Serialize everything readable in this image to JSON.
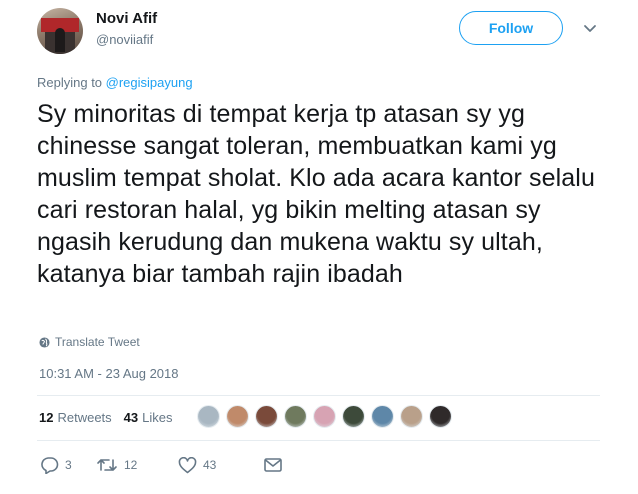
{
  "author": {
    "name": "Novi Afif",
    "handle": "@noviiafif"
  },
  "follow_label": "Follow",
  "reply_context": {
    "prefix": "Replying to ",
    "mention": "@regisipayung"
  },
  "tweet": {
    "text": "Sy minoritas di tempat kerja tp atasan sy yg chinesse sangat toleran, membuatkan kami yg muslim tempat sholat. Klo ada acara kantor selalu cari restoran halal, yg bikin melting atasan sy ngasih kerudung dan mukena waktu sy ultah, katanya biar tambah rajin ibadah",
    "translate_label": "Translate Tweet",
    "timestamp": "10:31 AM - 23 Aug 2018"
  },
  "stats": {
    "retweets_count": "12",
    "retweets_label": "Retweets",
    "likes_count": "43",
    "likes_label": "Likes"
  },
  "liker_avatars": [
    {
      "color": "#a9b7c2"
    },
    {
      "color": "#c08a6a"
    },
    {
      "color": "#7a4a3a"
    },
    {
      "color": "#6f7a5e"
    },
    {
      "color": "#d7a3b3"
    },
    {
      "color": "#3d4a3a"
    },
    {
      "color": "#5e87a8"
    },
    {
      "color": "#b9a08a"
    },
    {
      "color": "#2f2a2a"
    }
  ],
  "actions": {
    "reply_count": "3",
    "retweet_count": "12",
    "like_count": "43"
  },
  "icons": {
    "caret": "chevron-down-icon",
    "globe": "globe-icon",
    "reply": "reply-icon",
    "retweet": "retweet-icon",
    "like": "heart-icon",
    "message": "envelope-icon"
  },
  "colors": {
    "accent": "#1da1f2",
    "text": "#14171a",
    "secondary": "#657786",
    "divider": "#e6ecf0"
  }
}
